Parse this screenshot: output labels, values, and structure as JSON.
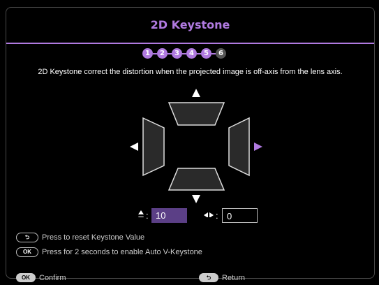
{
  "title": "2D Keystone",
  "steps": [
    "1",
    "2",
    "3",
    "4",
    "5",
    "6"
  ],
  "current_step": "6",
  "description": "2D Keystone correct the distortion when the projected image is off-axis from the lens axis.",
  "vertical": {
    "value": "10"
  },
  "horizontal": {
    "value": "0"
  },
  "hints": {
    "reset_text": "Press to reset Keystone Value",
    "auto_text": "Press for 2 seconds to enable Auto V-Keystone",
    "ok_label": "OK"
  },
  "footer": {
    "confirm_label": "Confirm",
    "return_label": "Return",
    "ok_label": "OK"
  },
  "colors": {
    "accent": "#b07ae0",
    "value_box": "#5b3f86"
  },
  "icons": {
    "up": "arrow-up-icon",
    "down": "arrow-down-icon",
    "left": "arrow-left-icon",
    "right": "arrow-right-icon",
    "back": "back-icon"
  }
}
